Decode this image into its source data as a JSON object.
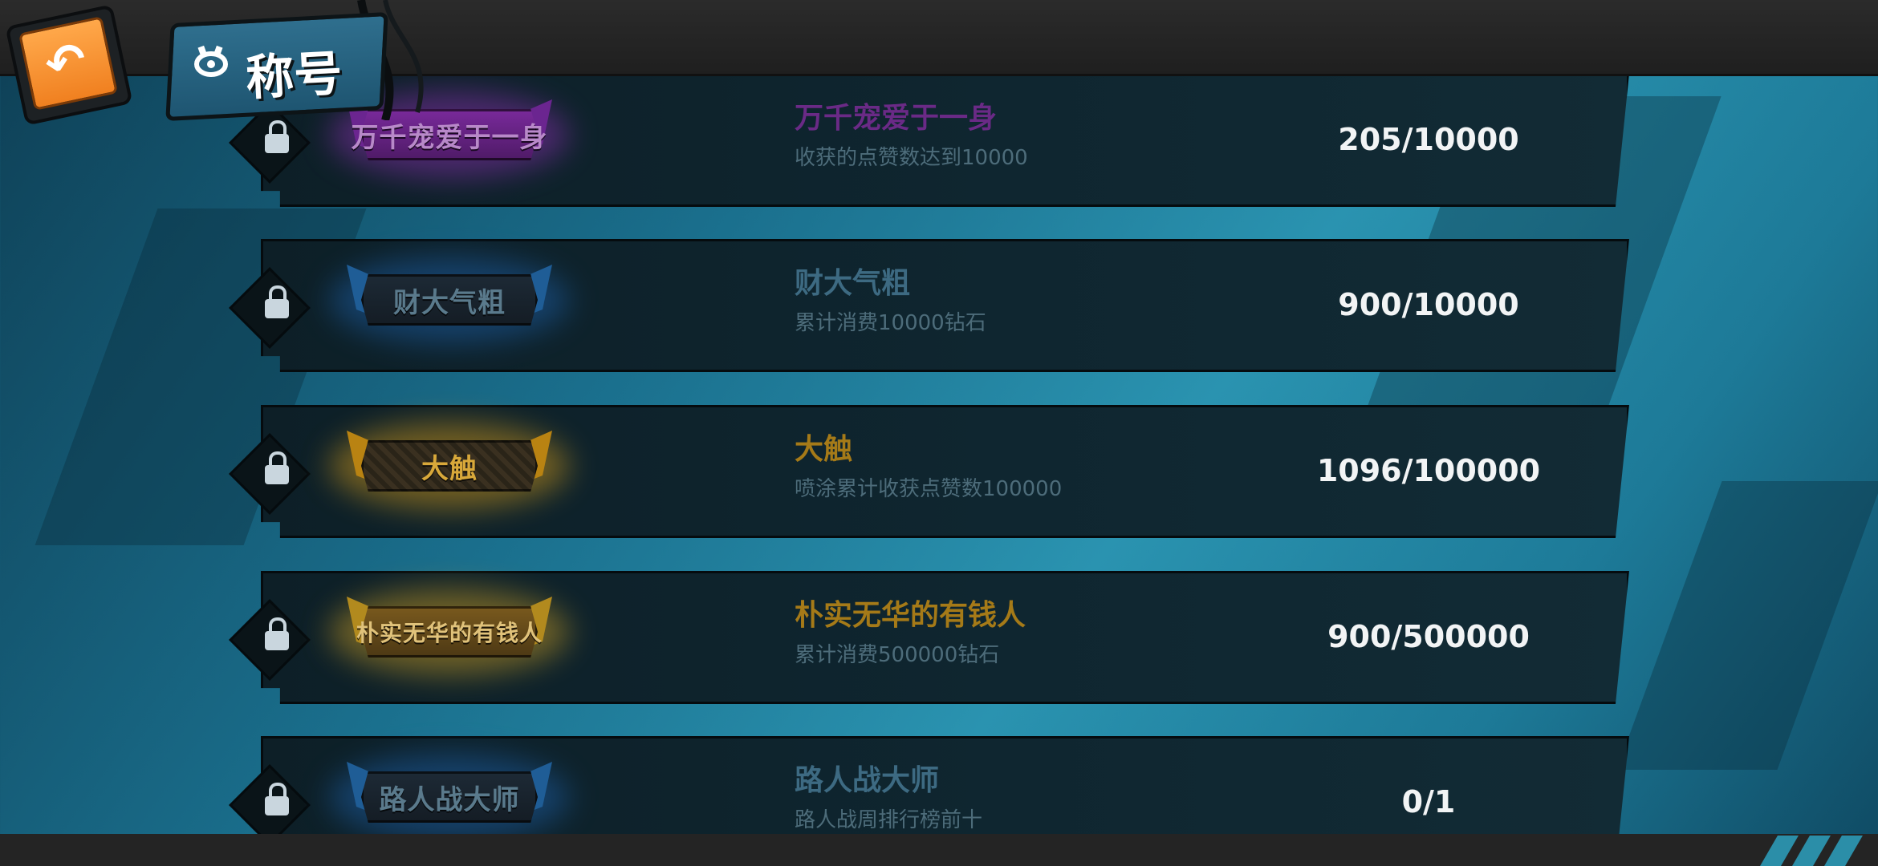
{
  "header": {
    "page_title": "称号",
    "back_icon": "back-arrow-icon"
  },
  "titles": [
    {
      "badge_text": "万千宠爱于一身",
      "name": "万千宠爱于一身",
      "description": "收获的点赞数达到10000",
      "progress": "205/10000",
      "locked": true,
      "theme_color": "#8a2fb0",
      "name_color": "#6a2a86"
    },
    {
      "badge_text": "财大气粗",
      "name": "财大气粗",
      "description": "累计消费10000钻石",
      "progress": "900/10000",
      "locked": true,
      "theme_color": "#2b6fb0",
      "name_color": "#3d6a82"
    },
    {
      "badge_text": "大触",
      "name": "大触",
      "description": "喷涂累计收获点赞数100000",
      "progress": "1096/100000",
      "locked": true,
      "theme_color": "#d39a1a",
      "name_color": "#a57a18"
    },
    {
      "badge_text": "朴实无华的有钱人",
      "name": "朴实无华的有钱人",
      "description": "累计消费500000钻石",
      "progress": "900/500000",
      "locked": true,
      "theme_color": "#c99c24",
      "name_color": "#a57a18"
    },
    {
      "badge_text": "路人战大师",
      "name": "路人战大师",
      "description": "路人战周排行榜前十",
      "progress": "0/1",
      "locked": true,
      "theme_color": "#2b6fb0",
      "name_color": "#3d6a82"
    }
  ]
}
